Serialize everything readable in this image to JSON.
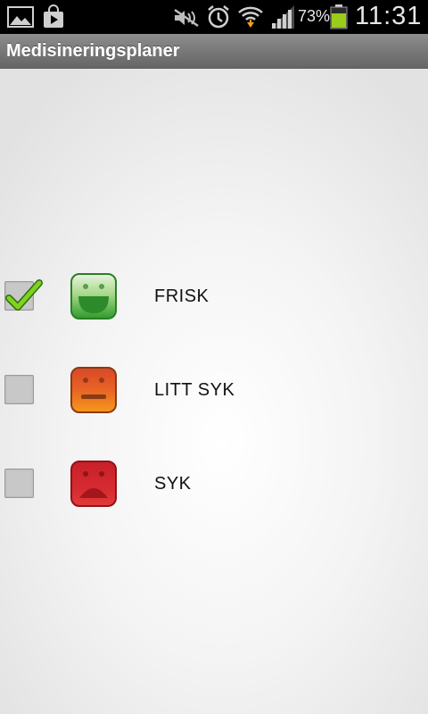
{
  "status_bar": {
    "battery_percent": "73%",
    "time": "11:31",
    "icons": [
      "gallery-icon",
      "store-icon",
      "mute-icon",
      "alarm-icon",
      "wifi-icon",
      "signal-icon",
      "battery-icon"
    ]
  },
  "app": {
    "title": "Medisineringsplaner"
  },
  "conditions": [
    {
      "label": "FRISK",
      "checked": true,
      "icon": "happy-face-icon",
      "color": "#3aa63a"
    },
    {
      "label": "LITT SYK",
      "checked": false,
      "icon": "neutral-face-icon",
      "color": "#e2621f"
    },
    {
      "label": "SYK",
      "checked": false,
      "icon": "sad-face-icon",
      "color": "#cf2228"
    }
  ]
}
